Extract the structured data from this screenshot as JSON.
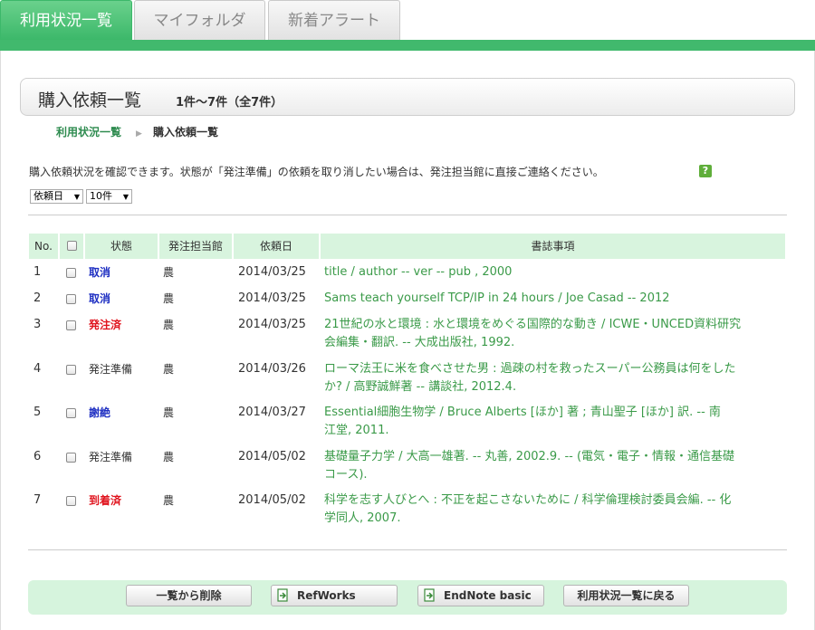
{
  "tabs": [
    {
      "label": "利用状況一覧",
      "active": true
    },
    {
      "label": "マイフォルダ",
      "active": false
    },
    {
      "label": "新着アラート",
      "active": false
    }
  ],
  "title": {
    "main": "購入依頼一覧",
    "count": "1件～7件（全7件）"
  },
  "breadcrumb": {
    "link": "利用状況一覧",
    "separator": "▶",
    "current": "購入依頼一覧"
  },
  "description": "購入依頼状況を確認できます。状態が「発注準備」の依頼を取り消したい場合は、発注担当館に直接ご連絡ください。",
  "help_icon": "?",
  "sort_select": {
    "value": "依頼日"
  },
  "count_select": {
    "value": "10件"
  },
  "table": {
    "headers": {
      "no": "No.",
      "status": "状態",
      "branch": "発注担当館",
      "date": "依頼日",
      "biblio": "書誌事項"
    },
    "rows": [
      {
        "no": "1",
        "status": "取消",
        "status_color": "blue",
        "branch": "農",
        "date": "2014/03/25",
        "biblio_line1": "title / author -- ver -- pub , 2000",
        "biblio_line2": ""
      },
      {
        "no": "2",
        "status": "取消",
        "status_color": "blue",
        "branch": "農",
        "date": "2014/03/25",
        "biblio_line1": "Sams teach yourself TCP/IP in 24 hours / Joe Casad -- 2012",
        "biblio_line2": ""
      },
      {
        "no": "3",
        "status": "発注済",
        "status_color": "red",
        "branch": "農",
        "date": "2014/03/25",
        "biblio_line1": "21世紀の水と環境 : 水と環境をめぐる国際的な動き / ICWE・UNCED資料研究",
        "biblio_line2": "会編集・翻訳. -- 大成出版社, 1992."
      },
      {
        "no": "4",
        "status": "発注準備",
        "status_color": "plain",
        "branch": "農",
        "date": "2014/03/26",
        "biblio_line1": "ローマ法王に米を食べさせた男 : 過疎の村を救ったスーパー公務員は何をした",
        "biblio_line2": "か? / 高野誠鮮著 -- 講談社, 2012.4."
      },
      {
        "no": "5",
        "status": "謝絶",
        "status_color": "blue",
        "branch": "農",
        "date": "2014/03/27",
        "biblio_line1": "Essential細胞生物学 / Bruce Alberts [ほか] 著 ; 青山聖子 [ほか] 訳. -- 南",
        "biblio_line2": "江堂, 2011."
      },
      {
        "no": "6",
        "status": "発注準備",
        "status_color": "plain",
        "branch": "農",
        "date": "2014/05/02",
        "biblio_line1": "基礎量子力学 / 大高一雄著. -- 丸善, 2002.9. -- (電気・電子・情報・通信基礎",
        "biblio_line2": "コース)."
      },
      {
        "no": "7",
        "status": "到着済",
        "status_color": "red",
        "branch": "農",
        "date": "2014/05/02",
        "biblio_line1": "科学を志す人びとへ : 不正を起こさないために / 科学倫理検討委員会編. -- 化",
        "biblio_line2": "学同人, 2007."
      }
    ]
  },
  "buttons": {
    "delete": "一覧から削除",
    "refworks": "RefWorks",
    "endnote": "EndNote basic",
    "back": "利用状況一覧に戻る"
  },
  "colors": {
    "green": "#41b96d",
    "link_green": "#3a9a48",
    "header_bg": "#d8f4de",
    "blue": "#1e2fc2",
    "red": "#e0141e"
  }
}
